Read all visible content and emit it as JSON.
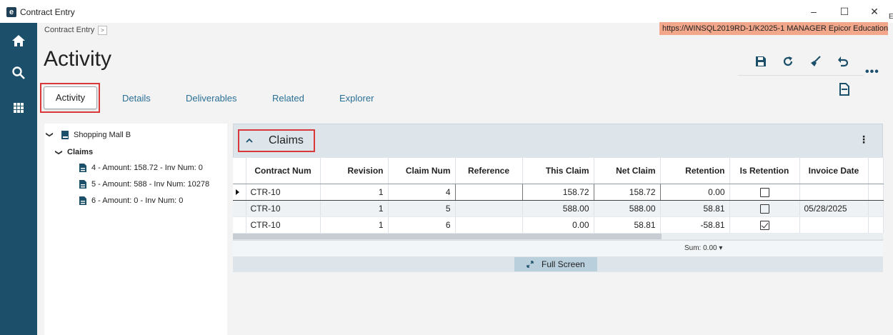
{
  "window": {
    "title": "Contract Entry",
    "logo_letter": "e",
    "edge_text": "E",
    "controls": {
      "minimize": "–",
      "maximize": "☐",
      "close": "✕"
    }
  },
  "nav": {
    "items": [
      "home-icon",
      "search-icon",
      "apps-grid-icon"
    ]
  },
  "header": {
    "breadcrumb": "Contract Entry",
    "breadcrumb_chevron": ">",
    "server": "https://WINSQL2019RD-1/K2025-1   MANAGER   Epicor Education",
    "page_title": "Activity"
  },
  "toolbar": {
    "icons": [
      "save-icon",
      "refresh-icon",
      "clear-icon",
      "undo-icon",
      "new-icon"
    ],
    "more": "•••"
  },
  "tabs": [
    {
      "label": "Activity",
      "active": true
    },
    {
      "label": "Details"
    },
    {
      "label": "Deliverables"
    },
    {
      "label": "Related"
    },
    {
      "label": "Explorer"
    }
  ],
  "tree": {
    "root": "Shopping Mall B",
    "group": "Claims",
    "items": [
      "4 - Amount: 158.72 - Inv Num: 0",
      "5 - Amount: 588 - Inv Num: 10278",
      "6 - Amount: 0 - Inv Num: 0"
    ]
  },
  "claims": {
    "title": "Claims",
    "columns": [
      "Contract Num",
      "Revision",
      "Claim Num",
      "Reference",
      "This Claim",
      "Net Claim",
      "Retention",
      "Is Retention",
      "Invoice Date"
    ],
    "rows": [
      [
        "CTR-10",
        "1",
        "4",
        "",
        "158.72",
        "158.72",
        "0.00",
        false,
        ""
      ],
      [
        "CTR-10",
        "1",
        "5",
        "",
        "588.00",
        "588.00",
        "58.81",
        false,
        "05/28/2025"
      ],
      [
        "CTR-10",
        "1",
        "6",
        "",
        "0.00",
        "58.81",
        "-58.81",
        true,
        ""
      ]
    ],
    "sum": "Sum: 0.00 ▾",
    "full_screen": "Full Screen"
  },
  "colors": {
    "nav": "#1c4f6a",
    "accent": "#2a6f96",
    "highlight": "#d9383a",
    "server_bg": "#f3a78a"
  }
}
